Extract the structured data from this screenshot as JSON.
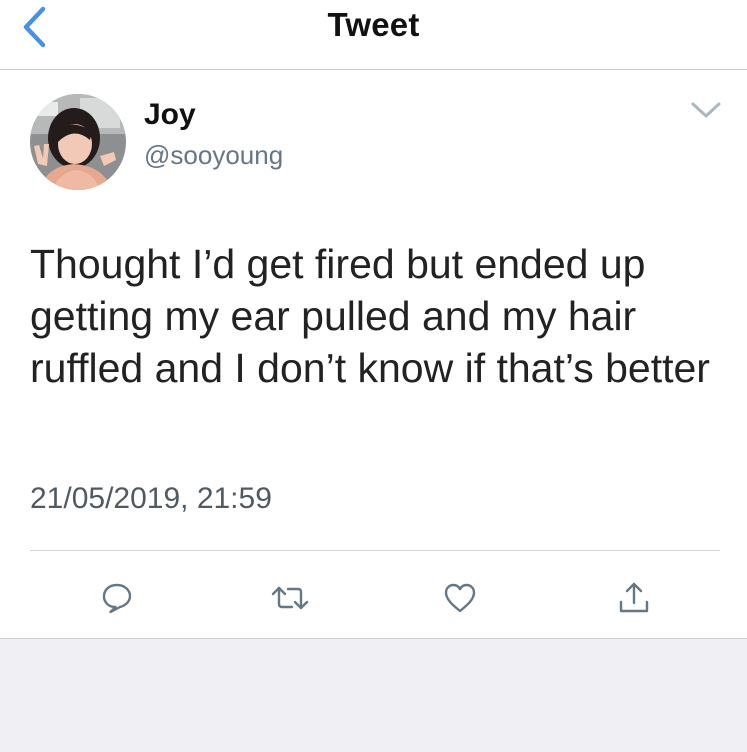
{
  "nav": {
    "title": "Tweet",
    "back_icon": "chevron-left-icon"
  },
  "tweet": {
    "display_name": "Joy",
    "username": "@sooyoung",
    "text": "Thought I’d get fired but ended up getting my ear pulled and my hair ruffled and I don’t know if that’s better",
    "timestamp": "21/05/2019, 21:59"
  },
  "actions": [
    {
      "name": "reply",
      "icon": "comment-icon"
    },
    {
      "name": "retweet",
      "icon": "retweet-icon"
    },
    {
      "name": "like",
      "icon": "heart-icon"
    },
    {
      "name": "share",
      "icon": "share-icon"
    }
  ],
  "colors": {
    "accent": "#4a90e2",
    "action_icon": "#657786",
    "secondary_text": "#657786",
    "footer_bg": "#efeff4"
  }
}
